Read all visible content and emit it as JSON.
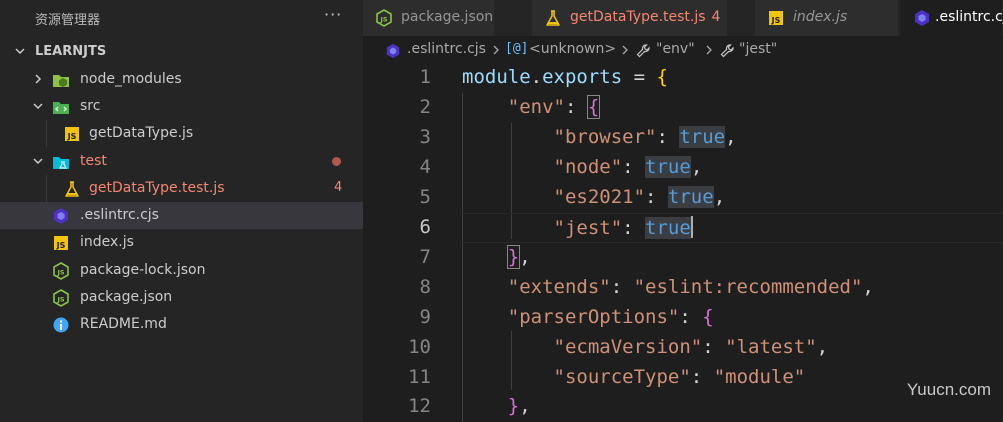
{
  "sidebar": {
    "title": "资源管理器",
    "more": "···",
    "root": "LEARNJTS",
    "items": [
      {
        "label": "node_modules",
        "icon": "node-folder-icon"
      },
      {
        "label": "src",
        "icon": "src-folder-icon"
      },
      {
        "label": "getDataType.js",
        "icon": "js-file-icon"
      },
      {
        "label": "test",
        "icon": "test-folder-icon"
      },
      {
        "label": "getDataType.test.js",
        "icon": "test-file-icon",
        "badge": "4"
      },
      {
        "label": ".eslintrc.cjs",
        "icon": "eslint-file-icon"
      },
      {
        "label": "index.js",
        "icon": "js-file-icon"
      },
      {
        "label": "package-lock.json",
        "icon": "nodejs-file-icon"
      },
      {
        "label": "package.json",
        "icon": "nodejs-file-icon"
      },
      {
        "label": "README.md",
        "icon": "info-file-icon"
      }
    ]
  },
  "tabs": [
    {
      "label": "package.json",
      "icon": "nodejs-file-icon"
    },
    {
      "label": "getDataType.test.js",
      "count": "4",
      "icon": "test-file-icon"
    },
    {
      "label": "index.js",
      "icon": "js-file-icon"
    },
    {
      "label": ".eslintrc.cjs",
      "icon": "eslint-file-icon"
    }
  ],
  "breadcrumb": {
    "file": ".eslintrc.cjs",
    "unknown": "<unknown>",
    "env": "\"env\"",
    "jest": "\"jest\""
  },
  "code": {
    "line_numbers": [
      "1",
      "2",
      "3",
      "4",
      "5",
      "6",
      "7",
      "8",
      "9",
      "10",
      "11",
      "12"
    ],
    "module": "module",
    "exports": "exports",
    "env_key": "\"env\"",
    "browser_key": "\"browser\"",
    "node_key": "\"node\"",
    "es2021_key": "\"es2021\"",
    "jest_key": "\"jest\"",
    "true_val": "true",
    "extends_key": "\"extends\"",
    "extends_val": "\"eslint:recommended\"",
    "parser_key": "\"parserOptions\"",
    "ecma_key": "\"ecmaVersion\"",
    "ecma_val": "\"latest\"",
    "source_key": "\"sourceType\"",
    "source_val": "\"module\""
  },
  "watermark": "Yuucn.com",
  "colors": {
    "error": "#f48771",
    "key": "#9cdcfe",
    "string": "#ce9178",
    "keyword": "#569cd6",
    "bracket_gold": "#ffd700",
    "bracket_purple": "#da70d6"
  }
}
